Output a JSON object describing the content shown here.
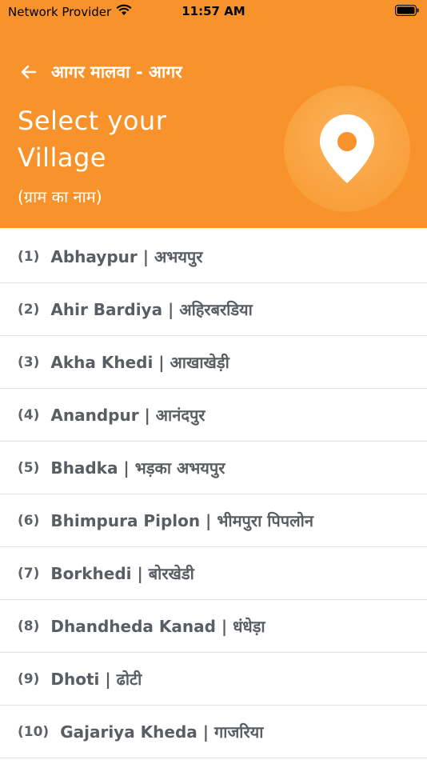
{
  "status_bar": {
    "carrier": "Network Provider",
    "time": "11:57 AM"
  },
  "header": {
    "title": "आगर मालवा - आगर",
    "headline_line1": "Select your",
    "headline_line2": "Village",
    "subtitle": "(ग्राम का नाम)",
    "background_color": "#f7932a",
    "icon": "location-pin-icon"
  },
  "villages": [
    {
      "num": "(1)",
      "name": "Abhaypur | अभयपुर"
    },
    {
      "num": "(2)",
      "name": "Ahir Bardiya | अहिरबरडिया"
    },
    {
      "num": "(3)",
      "name": "Akha Khedi | आखाखेड़ी"
    },
    {
      "num": "(4)",
      "name": "Anandpur | आनंदपुर"
    },
    {
      "num": "(5)",
      "name": "Bhadka | भड़का अभयपुर"
    },
    {
      "num": "(6)",
      "name": "Bhimpura Piplon | भीमपुरा पिपलोन"
    },
    {
      "num": "(7)",
      "name": "Borkhedi | बोरखेडी"
    },
    {
      "num": "(8)",
      "name": "Dhandheda Kanad | धंधेड़ा"
    },
    {
      "num": "(9)",
      "name": "Dhoti | ढोटी"
    },
    {
      "num": "(10)",
      "name": "Gajariya Kheda | गाजरिया"
    }
  ]
}
